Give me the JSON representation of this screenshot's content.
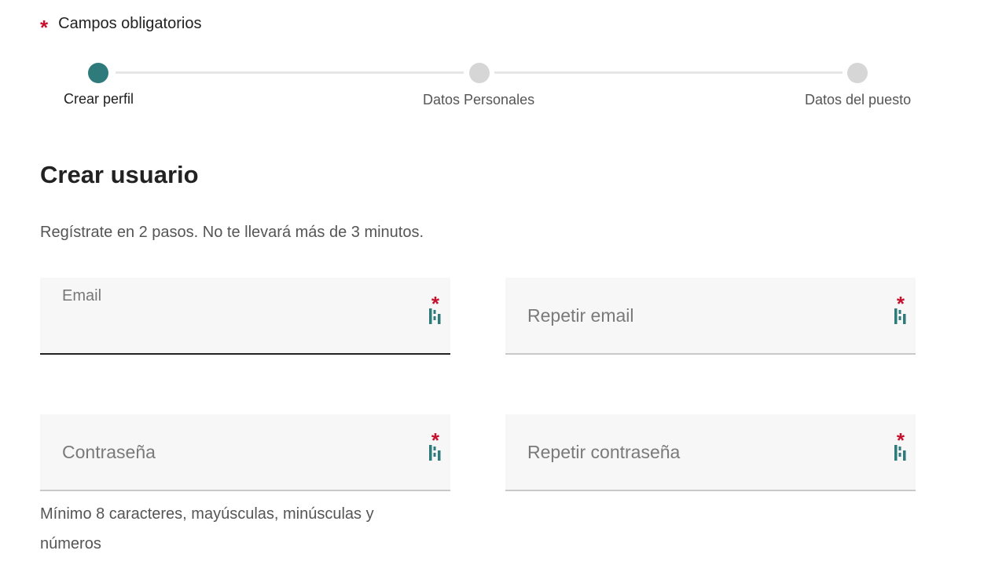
{
  "legend": {
    "star": "*",
    "text": "Campos obligatorios"
  },
  "stepper": {
    "steps": [
      {
        "label": "Crear perfil",
        "state": "active"
      },
      {
        "label": "Datos Personales",
        "state": "pending"
      },
      {
        "label": "Datos del puesto",
        "state": "pending"
      }
    ]
  },
  "form": {
    "title": "Crear usuario",
    "subtitle": "Regístrate en 2 pasos. No te llevará más de 3 minutos.",
    "email": {
      "label": "Email",
      "value": "",
      "required_mark": "*",
      "icon": "field-helper-icon"
    },
    "repeat_email": {
      "placeholder": "Repetir email",
      "value": "",
      "required_mark": "*",
      "icon": "field-helper-icon"
    },
    "password": {
      "placeholder": "Contraseña",
      "value": "",
      "required_mark": "*",
      "icon": "field-helper-icon"
    },
    "repeat_password": {
      "placeholder": "Repetir contraseña",
      "value": "",
      "required_mark": "*",
      "icon": "field-helper-icon"
    },
    "password_hint": "Mínimo 8 caracteres, mayúsculas, minúsculas y números"
  },
  "colors": {
    "accent": "#2f7b7b",
    "required": "#c8102e",
    "step_pending": "#d6d6d6",
    "field_bg": "#f7f7f7"
  }
}
